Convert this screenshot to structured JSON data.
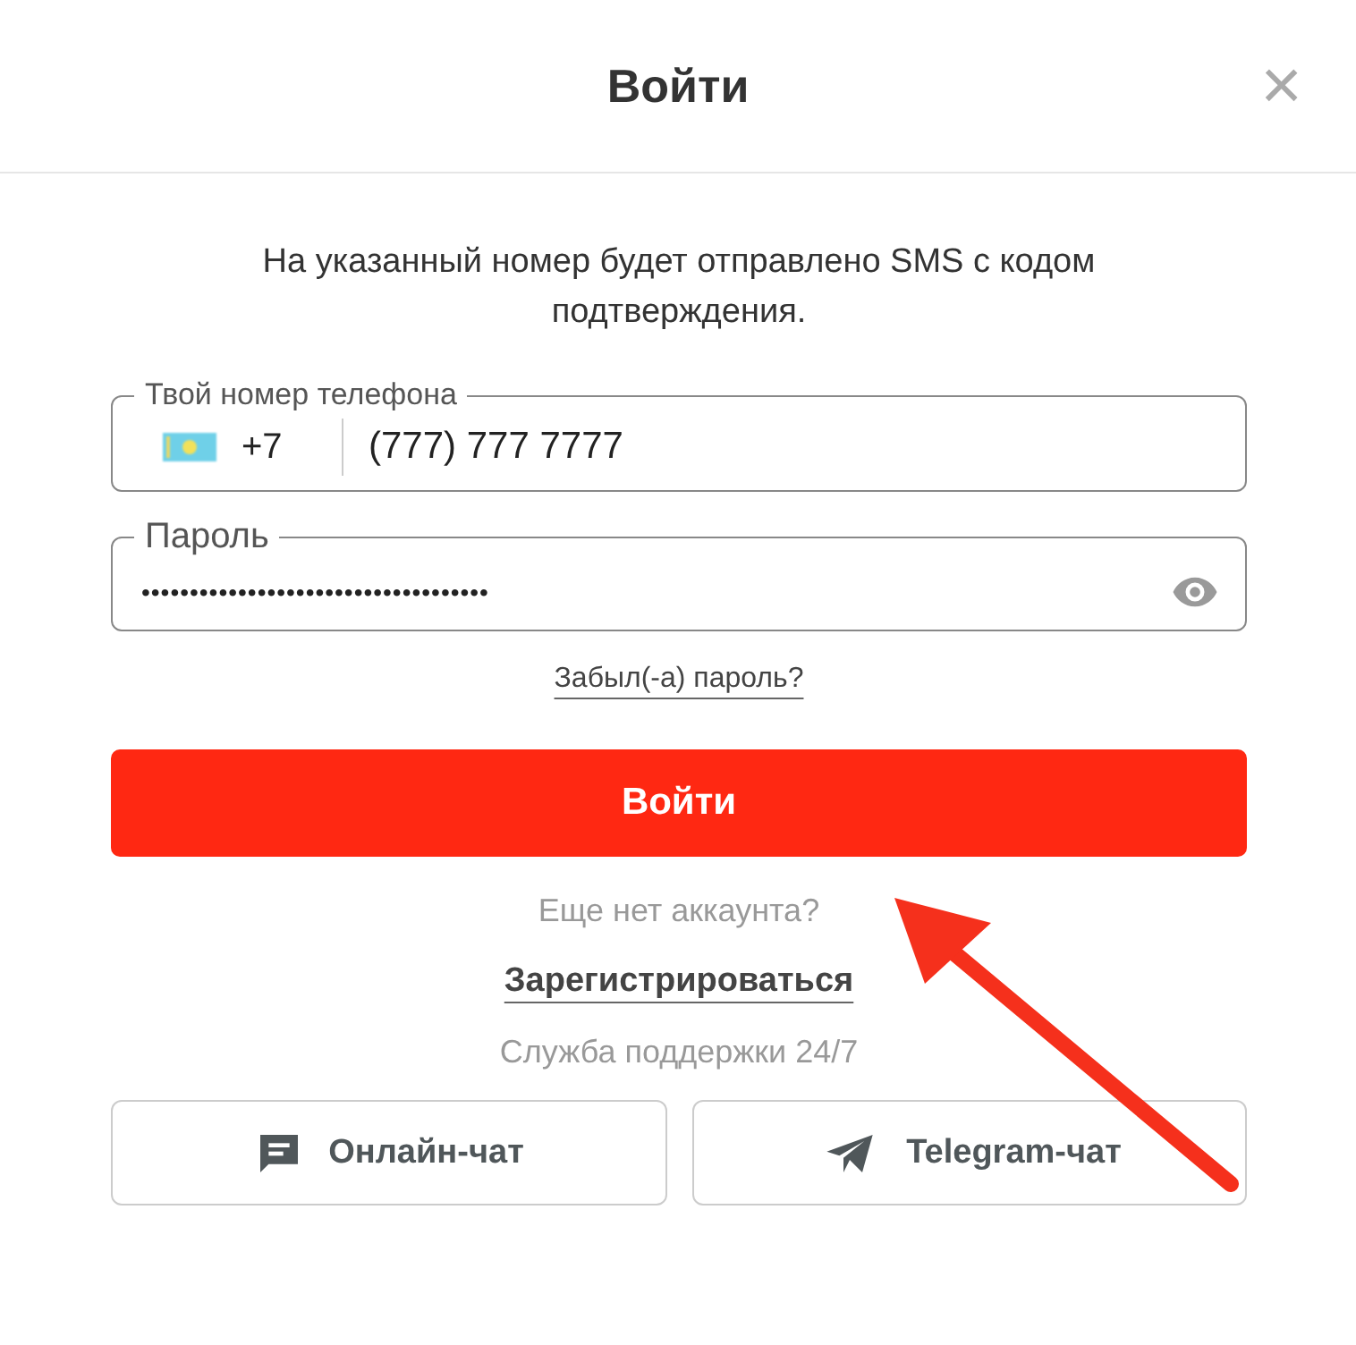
{
  "dialog": {
    "title": "Войти",
    "close": "×"
  },
  "intro": "На указанный номер будет отправлено SMS с кодом подтверждения.",
  "phone": {
    "label": "Твой номер телефона",
    "code": "+7",
    "value": "(777) 777 7777"
  },
  "password": {
    "label": "Пароль",
    "value": "••••••••••••••••••••••••••••••••••••"
  },
  "forgot_link": "Забыл(-а) пароль?",
  "submit": "Войти",
  "no_account": "Еще нет аккаунта?",
  "register_link": "Зарегистрироваться",
  "support": "Служба поддержки 24/7",
  "support_buttons": [
    {
      "kind": "chat",
      "label": "Онлайн-чат"
    },
    {
      "kind": "telegram",
      "label": "Telegram-чат"
    }
  ]
}
